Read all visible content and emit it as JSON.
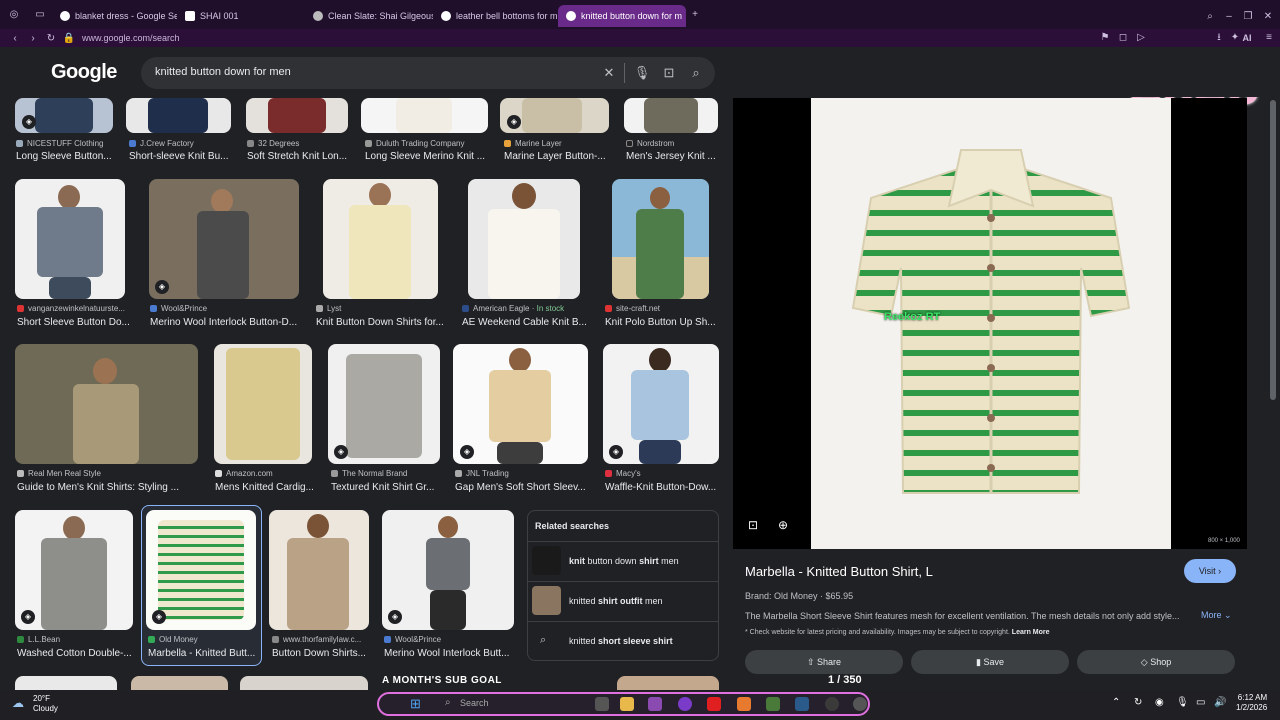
{
  "browser": {
    "tabs": [
      {
        "label": "blanket dress - Google Se",
        "active": false
      },
      {
        "label": "SHAI 001",
        "active": false
      },
      {
        "label": "Clean Slate: Shai Gilgeous",
        "active": false
      },
      {
        "label": "leather bell bottoms for m",
        "active": false
      },
      {
        "label": "knitted button down for m",
        "active": true
      }
    ],
    "url": "www.google.com/search",
    "new_tab": "+",
    "ai_label": "AI",
    "sticker_text": "2026"
  },
  "google": {
    "logo": "Google",
    "query": "knitted button down for men"
  },
  "grid": {
    "row1": [
      {
        "source": "NICESTUFF Clothing",
        "title": "Long Sleeve Button..."
      },
      {
        "source": "J.Crew Factory",
        "title": "Short-sleeve Knit Bu..."
      },
      {
        "source": "32 Degrees",
        "title": "Soft Stretch Knit Lon..."
      },
      {
        "source": "Duluth Trading Company",
        "title": "Long Sleeve Merino Knit ..."
      },
      {
        "source": "Marine Layer",
        "title": "Marine Layer Button-..."
      },
      {
        "source": "Nordstrom",
        "title": "Men's Jersey Knit ..."
      }
    ],
    "row2": [
      {
        "source": "vanganzewinkelnatuurste...",
        "title": "Short Sleeve Button Do..."
      },
      {
        "source": "Wool&Prince",
        "title": "Merino Wool Interlock Button-D..."
      },
      {
        "source": "Lyst",
        "title": "Knit Button Down Shirts for..."
      },
      {
        "source": "American Eagle",
        "stock": "In stock",
        "title": "AE Weekend Cable Knit B..."
      },
      {
        "source": "site-craft.net",
        "title": "Knit Polo Button Up Sh..."
      }
    ],
    "row3": [
      {
        "source": "Real Men Real Style",
        "title": "Guide to Men's Knit Shirts: Styling ..."
      },
      {
        "source": "Amazon.com",
        "title": "Mens Knitted Cardig..."
      },
      {
        "source": "The Normal Brand",
        "title": "Textured Knit Shirt Gr..."
      },
      {
        "source": "JNL Trading",
        "title": "Gap Men's Soft Short Sleev..."
      },
      {
        "source": "Macy's",
        "title": "Waffle-Knit Button-Dow..."
      }
    ],
    "row4": [
      {
        "source": "L.L.Bean",
        "title": "Washed Cotton Double-..."
      },
      {
        "source": "Old Money",
        "title": "Marbella - Knitted Butt..."
      },
      {
        "source": "www.thorfamilylaw.c...",
        "title": "Button Down Shirts..."
      },
      {
        "source": "Wool&Prince",
        "title": "Merino Wool Interlock Butt..."
      }
    ]
  },
  "related": {
    "title": "Related searches",
    "items": [
      {
        "pre": "knit",
        "mid": " button down ",
        "bold": "shirt",
        "post": " men"
      },
      {
        "pre": "knitted ",
        "mid": "",
        "bold": "shirt outfit",
        "post": " men"
      },
      {
        "pre": "knitted ",
        "mid": "",
        "bold": "short sleeve shirt",
        "post": ""
      }
    ]
  },
  "preview": {
    "dims": "800 × 1,000",
    "watermark": "Reekoz RT",
    "title": "Marbella - Knitted Button Shirt, L",
    "visit": "Visit",
    "brand": "Brand: Old Money",
    "price": "$65.95",
    "description": "The Marbella Short Sleeve Shirt features mesh for excellent ventilation. The mesh details not only add style...",
    "more": "More",
    "note": "* Check website for latest pricing and availability. Images may be subject to copyright.",
    "learn_more": "Learn More",
    "share": "Share",
    "save": "Save",
    "shop": "Shop",
    "pager": "1  / 350"
  },
  "taskbar": {
    "temp": "20°F",
    "condition": "Cloudy",
    "search": "Search",
    "banner": "A MONTH'S SUB GOAL",
    "time": "6:12 AM",
    "date": "1/2/2026"
  }
}
